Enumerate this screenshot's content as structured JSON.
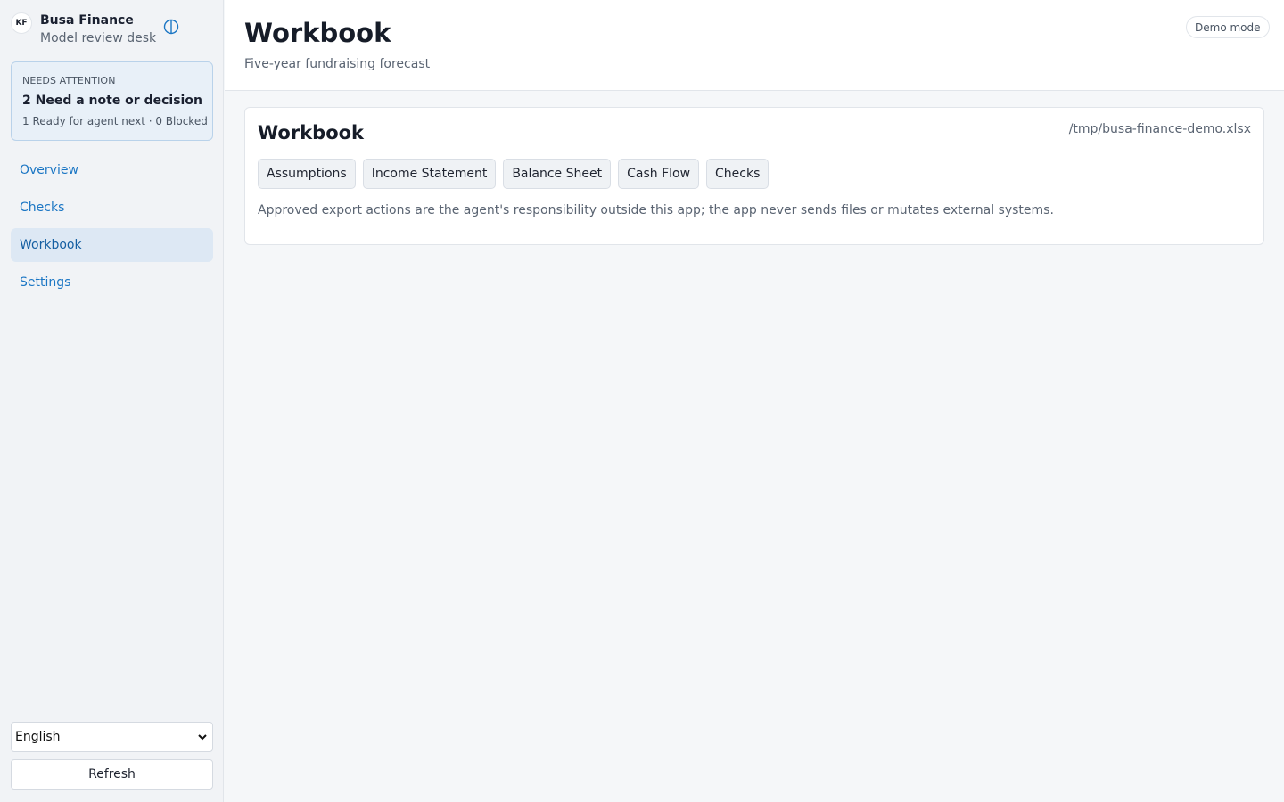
{
  "sidebar": {
    "brand": {
      "initials": "KF",
      "name": "Busa Finance",
      "subtitle": "Model review desk",
      "toggle_icon": "theme-toggle-icon"
    },
    "attention": {
      "label": "NEEDS ATTENTION",
      "title": "2 Need a note or decision",
      "meta": "1 Ready for agent next · 0 Blocked"
    },
    "nav": [
      {
        "label": "Overview",
        "active": false
      },
      {
        "label": "Checks",
        "active": false
      },
      {
        "label": "Workbook",
        "active": true
      },
      {
        "label": "Settings",
        "active": false
      }
    ],
    "language": {
      "selected": "English"
    },
    "refresh_label": "Refresh"
  },
  "header": {
    "title": "Workbook",
    "subtitle": "Five-year fundraising forecast",
    "badge": "Demo mode"
  },
  "card": {
    "title": "Workbook",
    "path": "/tmp/busa-finance-demo.xlsx",
    "tabs": [
      "Assumptions",
      "Income Statement",
      "Balance Sheet",
      "Cash Flow",
      "Checks"
    ],
    "note": "Approved export actions are the agent's responsibility outside this app; the app never sends files or mutates external systems."
  },
  "colors": {
    "accent": "#1b76c4",
    "attention_bg": "#e8f0f8",
    "attention_border": "#b9d2ea",
    "active_nav_bg": "#dde8f4"
  }
}
